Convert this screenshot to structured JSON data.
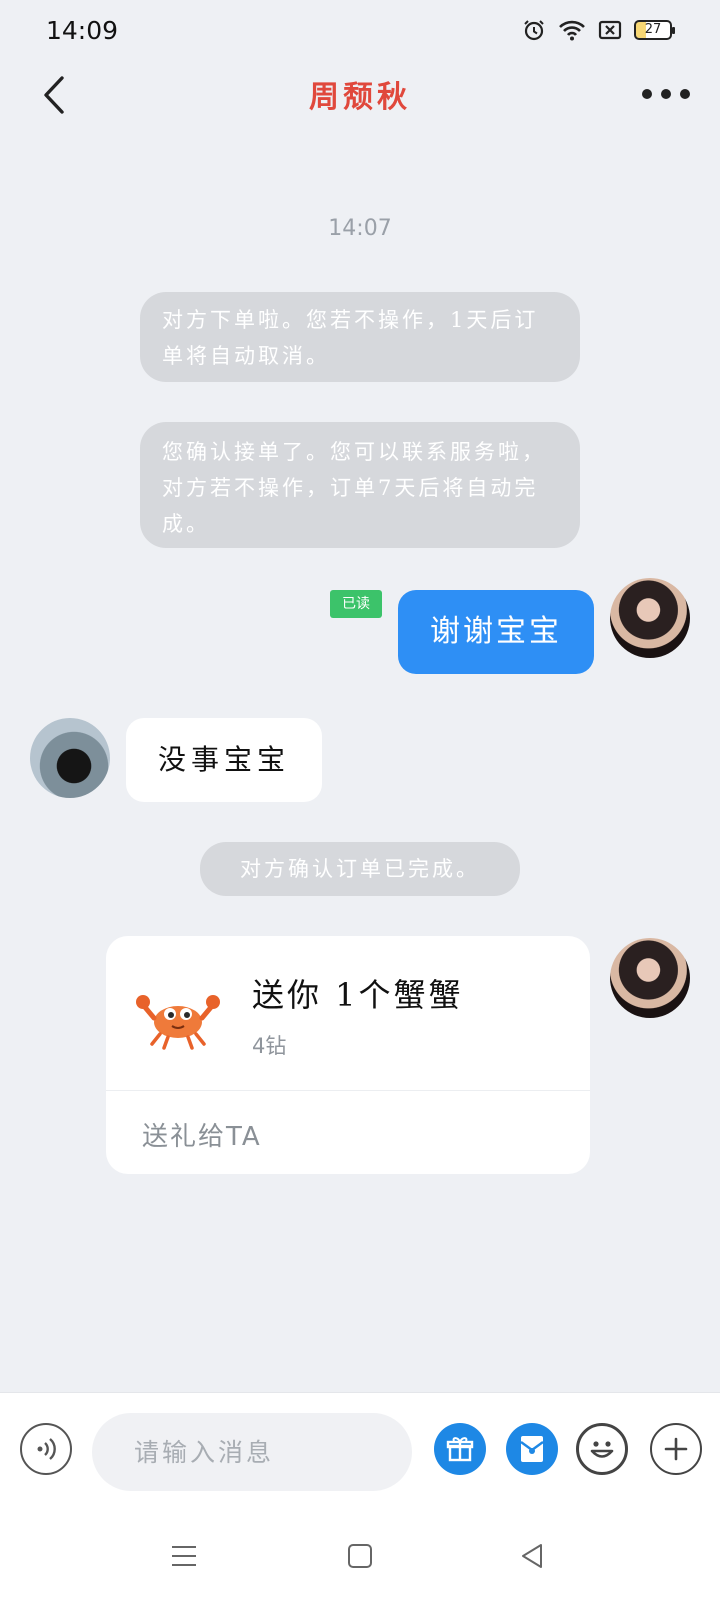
{
  "status_bar": {
    "time": "14:09",
    "battery": "27",
    "icons": [
      "alarm-icon",
      "wifi-icon",
      "sim-off-icon",
      "battery-icon"
    ]
  },
  "header": {
    "title": "周颓秋",
    "title_color": "#e0483c",
    "icons": [
      "back-chevron-icon",
      "more-dots-icon"
    ]
  },
  "chat": {
    "timestamp": "14:07",
    "system_messages": [
      "对方下单啦。您若不操作，1天后订单将自动取消。",
      "您确认接单了。您可以联系服务啦，对方若不操作，订单7天后将自动完成。",
      "对方确认订单已完成。"
    ],
    "my_message": {
      "read_status": "已读",
      "text": "谢谢宝宝"
    },
    "their_message": {
      "text": "没事宝宝"
    },
    "gift_card": {
      "title": "送你 1个蟹蟹",
      "price": "4钻",
      "action": "送礼给TA",
      "icon": "crab-icon"
    }
  },
  "input_bar": {
    "placeholder": "请输入消息",
    "icons": [
      "voice-icon",
      "gift-icon",
      "red-packet-icon",
      "emoji-icon",
      "plus-icon"
    ],
    "accent": "#1e88e5"
  },
  "nav_bar": {
    "icons": [
      "menu-icon",
      "home-square-icon",
      "back-triangle-icon"
    ]
  }
}
